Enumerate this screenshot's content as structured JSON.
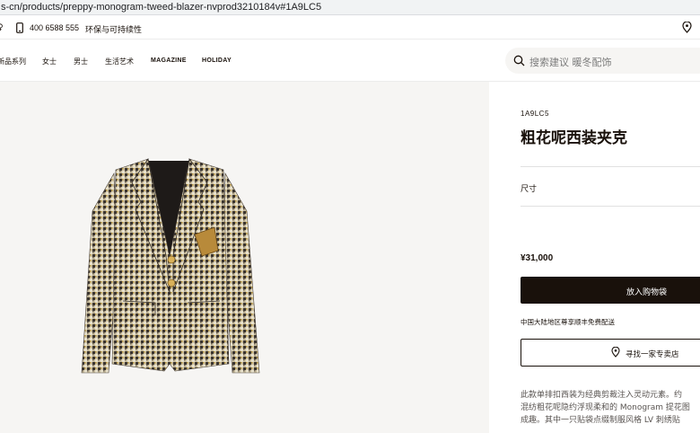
{
  "browser": {
    "url": "s-cn/products/preppy-monogram-tweed-blazer-nvprod3210184v#1A9LC5"
  },
  "topbar": {
    "phone_icon": "phone-icon",
    "phone": "400 6588 555",
    "sustainability": "环保与可持续性",
    "location_icon": "location-pin-icon"
  },
  "nav": {
    "items": [
      "新品系列",
      "女士",
      "男士",
      "生活艺术",
      "MAGAZINE",
      "HOLIDAY"
    ]
  },
  "search": {
    "icon": "search-icon",
    "placeholder": "搜索建议 暖冬配饰"
  },
  "product": {
    "sku": "1A9LC5",
    "title": "粗花呢西装夹克",
    "size_label": "尺寸",
    "price": "¥31,000",
    "add_to_cart": "放入购物袋",
    "shipping_note": "中国大陆地区尊享顺丰免费配送",
    "find_store": "寻找一家专卖店",
    "description": [
      "此款单排扣西装为经典剪裁注入灵动元素。约",
      "混纺粗花呢隐约浮现柔和的 Monogram 提花图",
      "成趣。其中一只贴袋点缀制服风格 LV 刺绣贴"
    ]
  },
  "colors": {
    "accent": "#19110b",
    "image_bg": "#f6f5f3"
  }
}
